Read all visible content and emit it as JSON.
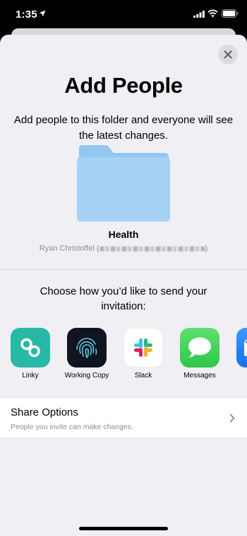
{
  "status_bar": {
    "time": "1:35",
    "icons": [
      "location-icon",
      "signal-icon",
      "wifi-icon",
      "battery-icon"
    ]
  },
  "sheet": {
    "close_icon": "close-icon",
    "title": "Add People",
    "description": "Add people to this folder and everyone will see the latest changes.",
    "folder": {
      "icon": "folder-icon",
      "name": "Health",
      "owner_name": "Ryan Christoffel",
      "owner_open": " (",
      "owner_close": ")"
    },
    "choose_text": "Choose how you’d like to send your invitation:",
    "apps": [
      {
        "label": "Linky",
        "icon": "linky-icon"
      },
      {
        "label": "Working Copy",
        "icon": "fingerprint-icon"
      },
      {
        "label": "Slack",
        "icon": "slack-icon"
      },
      {
        "label": "Messages",
        "icon": "message-bubble-icon"
      },
      {
        "label": "",
        "icon": "mail-icon"
      }
    ],
    "share_options": {
      "title": "Share Options",
      "subtitle": "People you invite can make changes."
    }
  },
  "colors": {
    "sheet_background": "#efeff4",
    "folder_blue": "#a6d3f5",
    "linky": "#27b9a6",
    "working_copy": "#101521",
    "messages": "#34c94a",
    "mail": "#1f7ff2",
    "secondary_text": "#8e8e93"
  }
}
